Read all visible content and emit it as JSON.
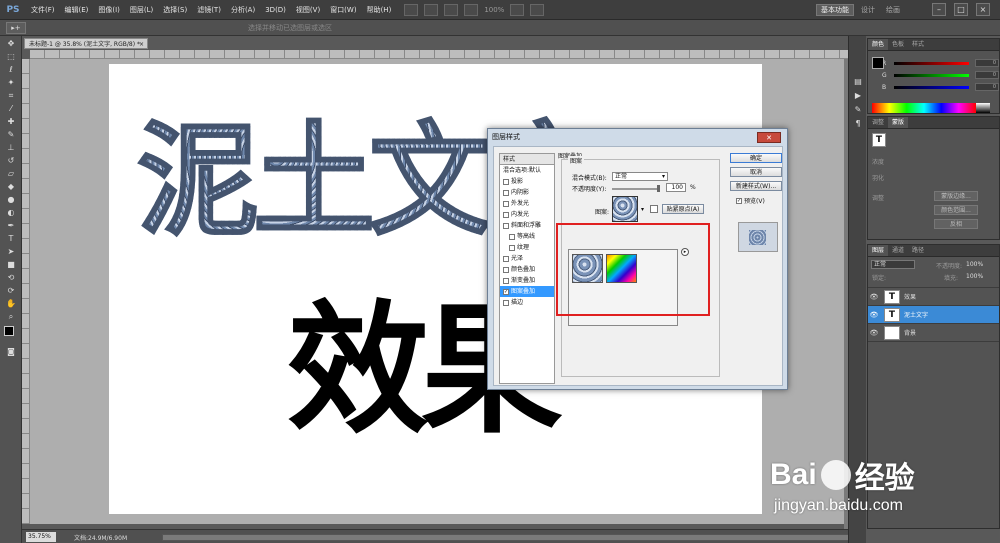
{
  "app": {
    "logo": "PS",
    "menu": [
      "文件(F)",
      "编辑(E)",
      "图像(I)",
      "图层(L)",
      "选择(S)",
      "滤镜(T)",
      "分析(A)",
      "3D(D)",
      "视图(V)",
      "窗口(W)",
      "帮助(H)"
    ],
    "zoom_value": "100%",
    "workspace_active": "基本功能",
    "workspace_links": [
      "设计",
      "绘画"
    ],
    "window_controls": [
      "–",
      "□",
      "×"
    ]
  },
  "options": {
    "hint": "选择并移动已选图层或选区"
  },
  "document": {
    "tab_title": "未标题-1 @ 35.8% (泥土文字, RGB/8) *",
    "tab_close": "×",
    "line1": "泥土文字",
    "line2": "效果",
    "status_zoom": "35.75%",
    "status_doc": "文档:24.9M/6.90M"
  },
  "color_panel": {
    "tabs": [
      "颜色",
      "色板",
      "样式"
    ],
    "channels": [
      {
        "label": "R",
        "value": "0",
        "color": "#e03030"
      },
      {
        "label": "G",
        "value": "0",
        "color": "#30c030"
      },
      {
        "label": "B",
        "value": "0",
        "color": "#3050e0"
      }
    ]
  },
  "adjust_panel": {
    "tabs": [
      "调整",
      "蒙版"
    ],
    "labels": [
      "浓度",
      "羽化",
      "调整"
    ],
    "buttons": [
      "蒙版边缘...",
      "颜色范围...",
      "反相"
    ]
  },
  "layers_panel": {
    "tabs": [
      "图层",
      "通道",
      "路径"
    ],
    "blend": "正常",
    "opacity_label": "不透明度:",
    "opacity": "100%",
    "lock_label": "锁定:",
    "fill_label": "填充:",
    "fill": "100%",
    "layers": [
      {
        "name": "效果",
        "thumb": "T",
        "selected": false
      },
      {
        "name": "泥土文字",
        "thumb": "T",
        "selected": true
      },
      {
        "name": "背景",
        "thumb": "",
        "selected": false
      }
    ]
  },
  "dialog": {
    "title": "图层样式",
    "close": "✕",
    "styles_header": "样式",
    "styles": [
      {
        "label": "混合选项:默认",
        "checkbox": false,
        "checked": false,
        "indent": false,
        "selected": false
      },
      {
        "label": "投影",
        "checkbox": true,
        "checked": false,
        "indent": false,
        "selected": false
      },
      {
        "label": "内阴影",
        "checkbox": true,
        "checked": false,
        "indent": false,
        "selected": false
      },
      {
        "label": "外发光",
        "checkbox": true,
        "checked": false,
        "indent": false,
        "selected": false
      },
      {
        "label": "内发光",
        "checkbox": true,
        "checked": false,
        "indent": false,
        "selected": false
      },
      {
        "label": "斜面和浮雕",
        "checkbox": true,
        "checked": false,
        "indent": false,
        "selected": false
      },
      {
        "label": "等高线",
        "checkbox": true,
        "checked": false,
        "indent": true,
        "selected": false
      },
      {
        "label": "纹理",
        "checkbox": true,
        "checked": false,
        "indent": true,
        "selected": false
      },
      {
        "label": "光泽",
        "checkbox": true,
        "checked": false,
        "indent": false,
        "selected": false
      },
      {
        "label": "颜色叠加",
        "checkbox": true,
        "checked": false,
        "indent": false,
        "selected": false
      },
      {
        "label": "渐变叠加",
        "checkbox": true,
        "checked": false,
        "indent": false,
        "selected": false
      },
      {
        "label": "图案叠加",
        "checkbox": true,
        "checked": true,
        "indent": false,
        "selected": true
      },
      {
        "label": "描边",
        "checkbox": true,
        "checked": false,
        "indent": false,
        "selected": false
      }
    ],
    "section_title": "图案叠加",
    "subsection": "图案",
    "blend_label": "混合模式(B):",
    "blend_value": "正常",
    "opacity_label": "不透明度(Y):",
    "opacity_value": "100",
    "opacity_level": 1.0,
    "percent": "%",
    "pattern_label": "图案:",
    "snap_button": "贴紧原点(A)",
    "buttons": [
      "确定",
      "取消",
      "新建样式(W)..."
    ],
    "preview_label": "预览(V)",
    "picker_menu": "▸"
  },
  "watermark": {
    "brand_left": "Bai",
    "brand_right": "经验",
    "url": "jingyan.baidu.com"
  },
  "icons": {
    "tools": [
      "move-icon",
      "marquee-icon",
      "lasso-icon",
      "wand-icon",
      "crop-icon",
      "eyedropper-icon",
      "heal-icon",
      "brush-icon",
      "stamp-icon",
      "history-brush-icon",
      "eraser-icon",
      "bucket-icon",
      "blur-icon",
      "dodge-icon",
      "pen-icon",
      "type-icon",
      "path-select-icon",
      "shape-icon",
      "3d-rotate-icon",
      "3d-orbit-icon",
      "hand-icon",
      "zoom-icon"
    ]
  }
}
